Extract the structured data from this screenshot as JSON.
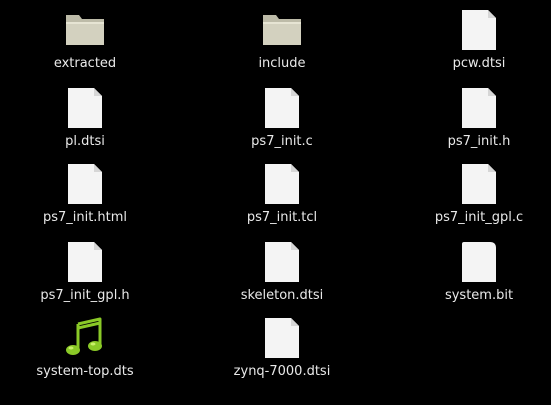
{
  "files": [
    {
      "name": "extracted",
      "icon": "folder-icon"
    },
    {
      "name": "include",
      "icon": "folder-icon"
    },
    {
      "name": "pcw.dtsi",
      "icon": "document-icon"
    },
    {
      "name": "pl.dtsi",
      "icon": "document-icon"
    },
    {
      "name": "ps7_init.c",
      "icon": "document-icon"
    },
    {
      "name": "ps7_init.h",
      "icon": "document-icon"
    },
    {
      "name": "ps7_init.html",
      "icon": "document-icon"
    },
    {
      "name": "ps7_init.tcl",
      "icon": "document-icon"
    },
    {
      "name": "ps7_init_gpl.c",
      "icon": "document-icon"
    },
    {
      "name": "ps7_init_gpl.h",
      "icon": "document-icon"
    },
    {
      "name": "skeleton.dtsi",
      "icon": "document-icon"
    },
    {
      "name": "system.bit",
      "icon": "document-icon"
    },
    {
      "name": "system-top.dts",
      "icon": "audio-file-icon"
    },
    {
      "name": "zynq-7000.dtsi",
      "icon": "document-icon"
    }
  ],
  "colors": {
    "background": "#000000",
    "label_text": "#e9e9e9",
    "folder": "#d3d1bf",
    "document": "#f4f4f4",
    "audio_icon": "#8ac927"
  }
}
